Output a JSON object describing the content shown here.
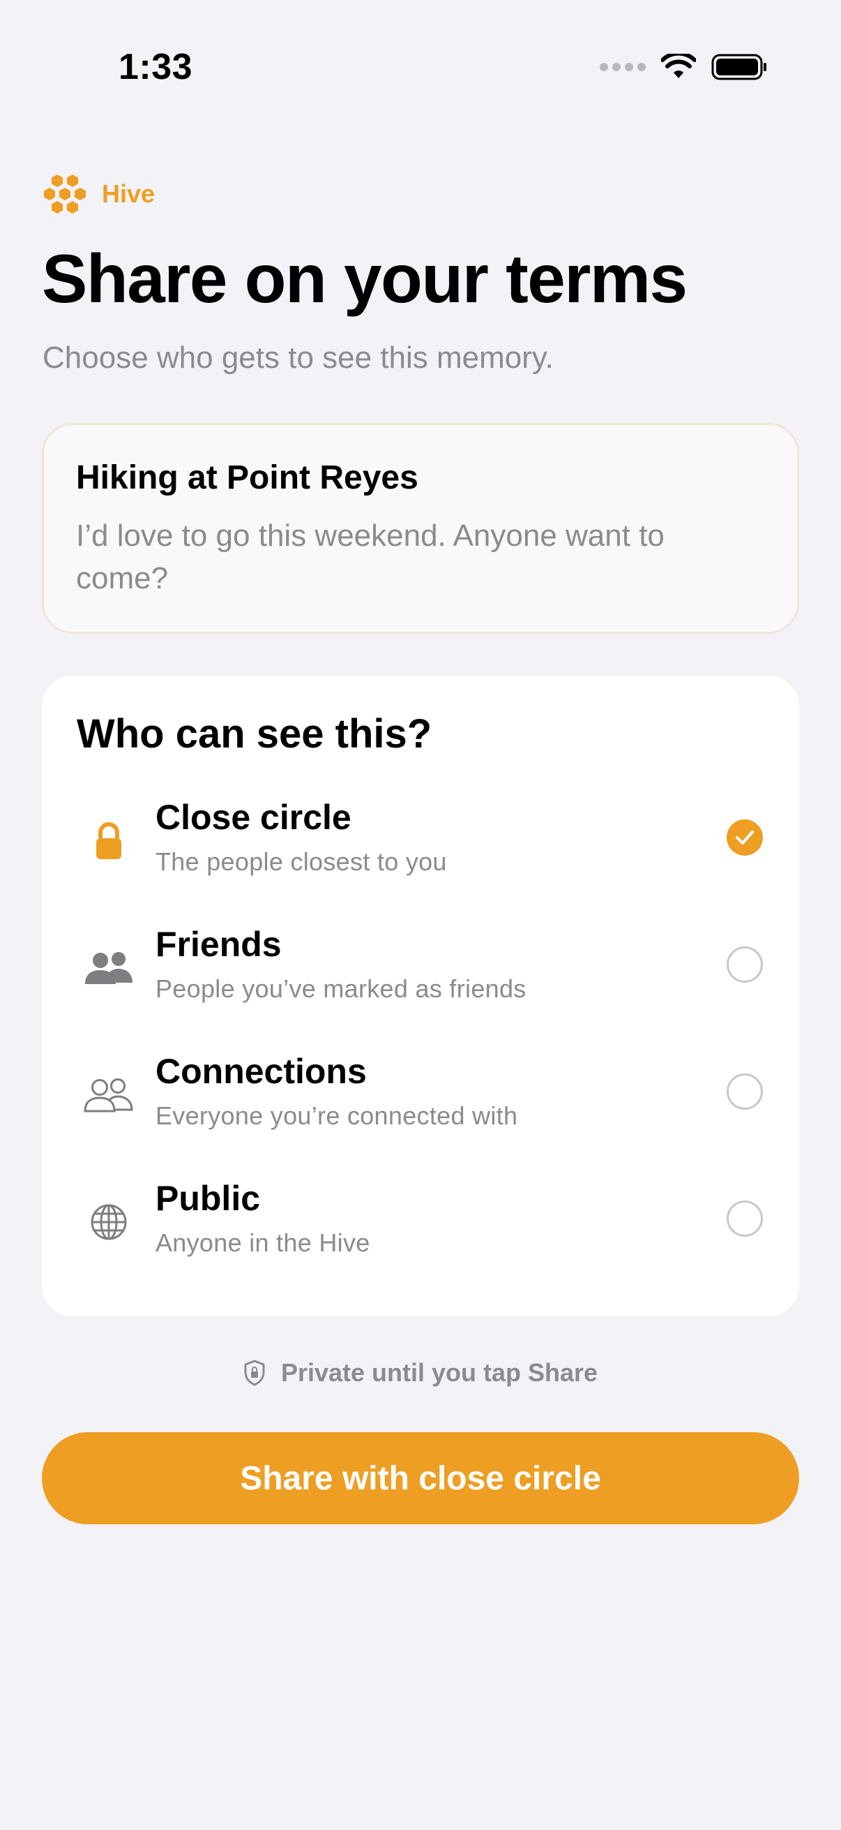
{
  "status_bar": {
    "time": "1:33"
  },
  "brand": {
    "name": "Hive",
    "icon": "honeycomb-icon"
  },
  "header": {
    "title": "Share on your terms",
    "subtitle": "Choose who gets to see this memory."
  },
  "post": {
    "title": "Hiking at Point Reyes",
    "body": "I’d love to go this weekend. Anyone want to come?"
  },
  "audience": {
    "heading": "Who can see this?",
    "options": [
      {
        "title": "Close circle",
        "description": "The people closest to you",
        "icon": "lock-icon",
        "selected": true
      },
      {
        "title": "Friends",
        "description": "People you’ve marked as friends",
        "icon": "friends-icon",
        "selected": false
      },
      {
        "title": "Connections",
        "description": "Everyone you’re connected with",
        "icon": "connections-icon",
        "selected": false
      },
      {
        "title": "Public",
        "description": "Anyone in the Hive",
        "icon": "globe-icon",
        "selected": false
      }
    ]
  },
  "privacy_note": {
    "text": "Private until you tap Share",
    "icon": "shield-icon"
  },
  "share_button": {
    "label": "Share with close circle"
  },
  "colors": {
    "accent": "#EE9E22",
    "background": "#F2F2F7",
    "secondary_text": "#8A8A8F",
    "icon_gray": "#7D7D82"
  }
}
